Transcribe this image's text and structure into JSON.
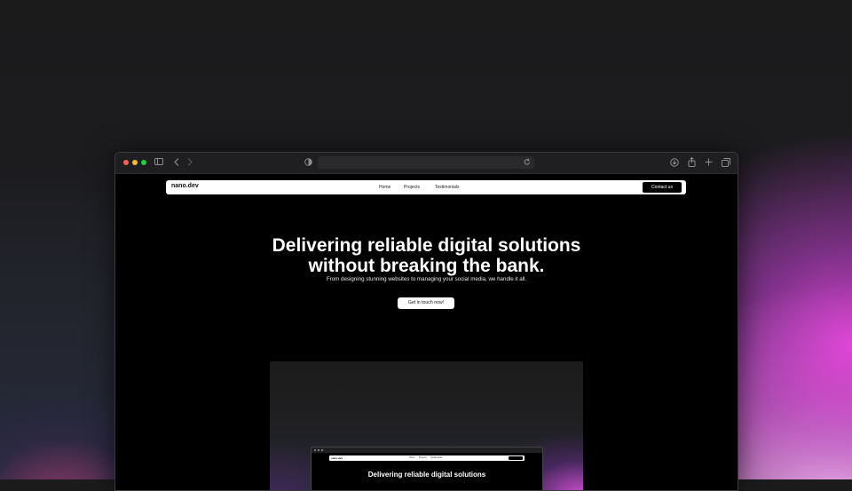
{
  "site": {
    "logo": "nano.dev",
    "nav": [
      "Home",
      "Projects",
      "Testimonials"
    ],
    "contact_label": "Contact us"
  },
  "hero": {
    "title_line1": "Delivering reliable digital solutions",
    "title_line2": "without breaking the bank.",
    "subtitle": "From designing stunning websites to managing your social media, we handle it all.",
    "cta_label": "Get in touch now!"
  },
  "preview": {
    "logo": "nano.dev",
    "nav": [
      "Home",
      "Projects",
      "Testimonials"
    ],
    "title": "Delivering reliable digital solutions"
  },
  "colors": {
    "traffic_red": "#fe5f57",
    "traffic_yellow": "#febc2e",
    "traffic_green": "#28c840",
    "accent_pink": "#e046dc"
  }
}
